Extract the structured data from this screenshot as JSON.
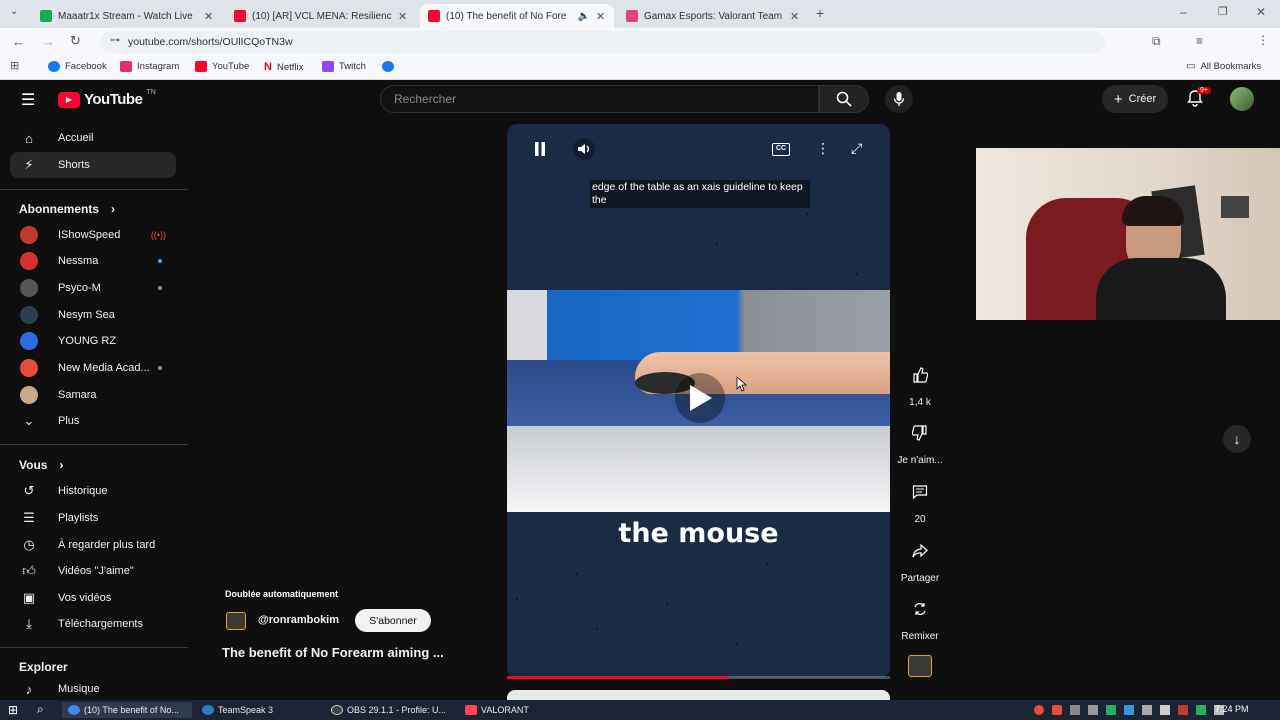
{
  "browser": {
    "tabs": [
      {
        "title": "Maaatr1x Stream - Watch Live",
        "favicon_color": "#1aaa55"
      },
      {
        "title": "(10) [AR] VCL MENA: Resilience",
        "favicon_color": "#ff0033"
      },
      {
        "title": "(10) The benefit of No Fore",
        "favicon_color": "#ff0033"
      },
      {
        "title": "Gamax Esports: Valorant Team",
        "favicon_color": "#e0427a"
      }
    ],
    "url": "youtube.com/shorts/OUlICQoTN3w",
    "bookmarks": [
      {
        "label": "Facebook",
        "color": "#1877f2"
      },
      {
        "label": "Instagram",
        "color": "#e1306c"
      },
      {
        "label": "YouTube",
        "color": "#ff0033"
      },
      {
        "label": "Netflix",
        "color": "#e50914"
      },
      {
        "label": "Twitch",
        "color": "#9146ff"
      },
      {
        "label": "",
        "color": "#1877f2"
      }
    ],
    "all_bookmarks": "All Bookmarks"
  },
  "youtube": {
    "logo": "YouTube",
    "logo_country": "TN",
    "search_placeholder": "Rechercher",
    "create_label": "Créer",
    "notif_badge": "9+",
    "nav": [
      {
        "label": "Accueil",
        "icon": "home-icon"
      },
      {
        "label": "Shorts",
        "icon": "shorts-icon"
      }
    ],
    "subs_heading": "Abonnements",
    "subscriptions": [
      {
        "name": "IShowSpeed",
        "color": "#c0392b",
        "live": true
      },
      {
        "name": "Nessma",
        "color": "#d63031",
        "live": false,
        "dot": true
      },
      {
        "name": "Psyco-M",
        "color": "#555555",
        "live": false,
        "dot": true
      },
      {
        "name": "Nesym Sea",
        "color": "#2c3e50",
        "live": false,
        "dot": false
      },
      {
        "name": "YOUNG RZ",
        "color": "#2d6cdf",
        "live": false,
        "dot": false
      },
      {
        "name": "New Media Acad...",
        "color": "#e74c3c",
        "live": false,
        "dot": true
      },
      {
        "name": "Samara",
        "color": "#c8a98a",
        "live": false,
        "dot": false
      }
    ],
    "more_label": "Plus",
    "you_heading": "Vous",
    "you_items": [
      {
        "label": "Historique",
        "icon": "history-icon"
      },
      {
        "label": "Playlists",
        "icon": "playlists-icon"
      },
      {
        "label": "À regarder plus tard",
        "icon": "watch-later-icon"
      },
      {
        "label": "Vidéos \"J'aime\"",
        "icon": "liked-icon"
      },
      {
        "label": "Vos vidéos",
        "icon": "your-videos-icon"
      },
      {
        "label": "Téléchargements",
        "icon": "downloads-icon"
      }
    ],
    "explore_heading": "Explorer",
    "explore_items": [
      {
        "label": "Musique",
        "icon": "music-icon"
      }
    ],
    "short": {
      "caption_top": "edge of the table as an xais guideline to keep the",
      "caption_big": "the mouse",
      "dubbed_label": "Doublée automatiquement",
      "channel": "@ronrambokim",
      "subscribe": "S'abonner",
      "title": "The benefit of No Forearm aiming ...",
      "progress": 0.58,
      "likes": "1,4 k",
      "dislike_label": "Je n'aim...",
      "comments": "20",
      "share_label": "Partager",
      "remix_label": "Remixer"
    }
  },
  "taskbar": {
    "items": [
      {
        "label": "(10) The benefit of No...",
        "color": "#4285f4"
      },
      {
        "label": "TeamSpeak 3",
        "color": "#2580c3"
      },
      {
        "label": "OBS 29.1.1 - Profile: U...",
        "color": "#444444"
      },
      {
        "label": "VALORANT",
        "color": "#ff4655"
      }
    ],
    "clock": "7:24 PM"
  }
}
